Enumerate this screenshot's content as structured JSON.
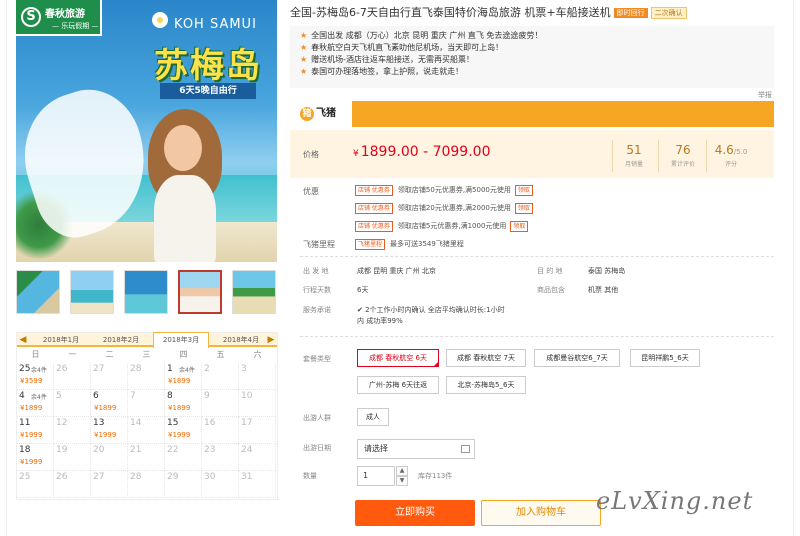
{
  "hero": {
    "logo_mark": "S",
    "logo_line1": "春秋旅游",
    "logo_line2": "— 乐玩假期 —",
    "destination_en": "KOH SAMUI",
    "destination_cn": "苏梅岛",
    "duration": "6天5晚自由行"
  },
  "thumbnails": [
    {
      "name": "thumb-1",
      "selected": false
    },
    {
      "name": "thumb-2",
      "selected": false
    },
    {
      "name": "thumb-3",
      "selected": false
    },
    {
      "name": "thumb-4",
      "selected": true
    },
    {
      "name": "thumb-5",
      "selected": false
    }
  ],
  "calendar": {
    "months": [
      "2018年1月",
      "2018年2月",
      "2018年3月",
      "2018年4月"
    ],
    "selected_month": "2018年3月",
    "weekdays": [
      "日",
      "一",
      "二",
      "三",
      "四",
      "五",
      "六"
    ],
    "rows": [
      [
        {
          "d": "25",
          "on": true,
          "st": "余4件",
          "p": "¥3599"
        },
        {
          "d": "26"
        },
        {
          "d": "27"
        },
        {
          "d": "28"
        },
        {
          "d": "1",
          "on": true,
          "st": "余4件",
          "p": "¥1899"
        },
        {
          "d": "2"
        },
        {
          "d": "3"
        }
      ],
      [
        {
          "d": "4",
          "on": true,
          "st": "余4件",
          "p": "¥1899"
        },
        {
          "d": "5"
        },
        {
          "d": "6",
          "on": true,
          "st": "",
          "p": "¥1899"
        },
        {
          "d": "7"
        },
        {
          "d": "8",
          "on": true,
          "st": "",
          "p": "¥1899"
        },
        {
          "d": "9"
        },
        {
          "d": "10"
        }
      ],
      [
        {
          "d": "11",
          "on": true,
          "st": "",
          "p": "¥1999"
        },
        {
          "d": "12"
        },
        {
          "d": "13",
          "on": true,
          "st": "",
          "p": "¥1999"
        },
        {
          "d": "14"
        },
        {
          "d": "15",
          "on": true,
          "st": "",
          "p": "¥1999"
        },
        {
          "d": "16"
        },
        {
          "d": "17"
        }
      ],
      [
        {
          "d": "18",
          "on": true,
          "st": "",
          "p": "¥1999"
        },
        {
          "d": "19"
        },
        {
          "d": "20"
        },
        {
          "d": "21"
        },
        {
          "d": "22"
        },
        {
          "d": "23"
        },
        {
          "d": "24"
        }
      ],
      [
        {
          "d": "25"
        },
        {
          "d": "26"
        },
        {
          "d": "27"
        },
        {
          "d": "28"
        },
        {
          "d": "29"
        },
        {
          "d": "30"
        },
        {
          "d": "31"
        }
      ]
    ]
  },
  "product": {
    "title": "全国-苏梅岛6-7天自由行直飞泰国特价海岛旅游 机票+车船接送机",
    "tag_instant": "即时回行",
    "tag_confirm": "二次确认",
    "features": [
      "全国出发 成都（万心）北京 昆明 重庆 广州 直飞 免去途途疲劳！",
      "春秋航空白天飞机直飞素叻他尼机场，当天即可上岛！",
      "赠送机场-酒店往返车船接送，无需再买船票！",
      "泰国可办理落地签，拿上护照，说走就走！"
    ],
    "report": "举报",
    "platform": "飞猪",
    "price_label": "价格",
    "price_currency": "¥",
    "price_range": "1899.00 - 7099.00",
    "stats": [
      {
        "value": "51",
        "suffix": "",
        "caption": "月销量"
      },
      {
        "value": "76",
        "suffix": "",
        "caption": "累计评价"
      },
      {
        "value": "4.6",
        "suffix": "/5.0",
        "caption": "评分"
      }
    ],
    "promo_label": "优惠",
    "coupons": [
      {
        "tag": "店铺 优惠券",
        "text": "领取店铺50元优惠券,满5000元使用",
        "action": "领取"
      },
      {
        "tag": "店铺 优惠券",
        "text": "领取店铺20元优惠券,满2000元使用",
        "action": "领取"
      },
      {
        "tag": "店铺 优惠券",
        "text": "领取店铺5元优惠券,满1000元使用",
        "action": "领取"
      }
    ],
    "points_label": "飞猪里程",
    "points_tag": "飞猪里程",
    "points_text": "最多可送3549飞猪里程",
    "depart_label": "出 发 地",
    "depart_value": "成都   昆明   重庆   广州   北京",
    "dest_label": "目 的 地",
    "dest_value": "泰国   苏梅岛",
    "days_label": "行程天数",
    "days_value": "6天",
    "includes_label": "商品包含",
    "includes_value": "机票   其他",
    "service_label": "服务承诺",
    "service_line1": "2个工作小时内确认 全店平均确认时长:1小时",
    "service_line2": "内 成功率99%",
    "package_label": "套餐类型",
    "packages": [
      {
        "label": "成都 春秋航空 6天",
        "selected": true
      },
      {
        "label": "成都 春秋航空 7天",
        "selected": false
      },
      {
        "label": "成都曼谷航空6_7天",
        "selected": false
      },
      {
        "label": "昆明祥鹏5_6天",
        "selected": false
      },
      {
        "label": "广州-苏梅 6天往返",
        "selected": false
      },
      {
        "label": "北京-苏梅岛5_6天",
        "selected": false
      }
    ],
    "people_label": "出游人群",
    "people_value": "成人",
    "date_label": "出游日期",
    "date_value": "请选择",
    "qty_label": "数量",
    "qty_value": "1",
    "stock": "库存113件",
    "buy_label": "立即购买",
    "cart_label": "加入购物车"
  },
  "watermark": "eLvXing.net",
  "colors": {
    "accent": "#f6a623",
    "price": "#e2001a",
    "buy": "#ff5a0d",
    "brand_green": "#1e8e4a"
  }
}
